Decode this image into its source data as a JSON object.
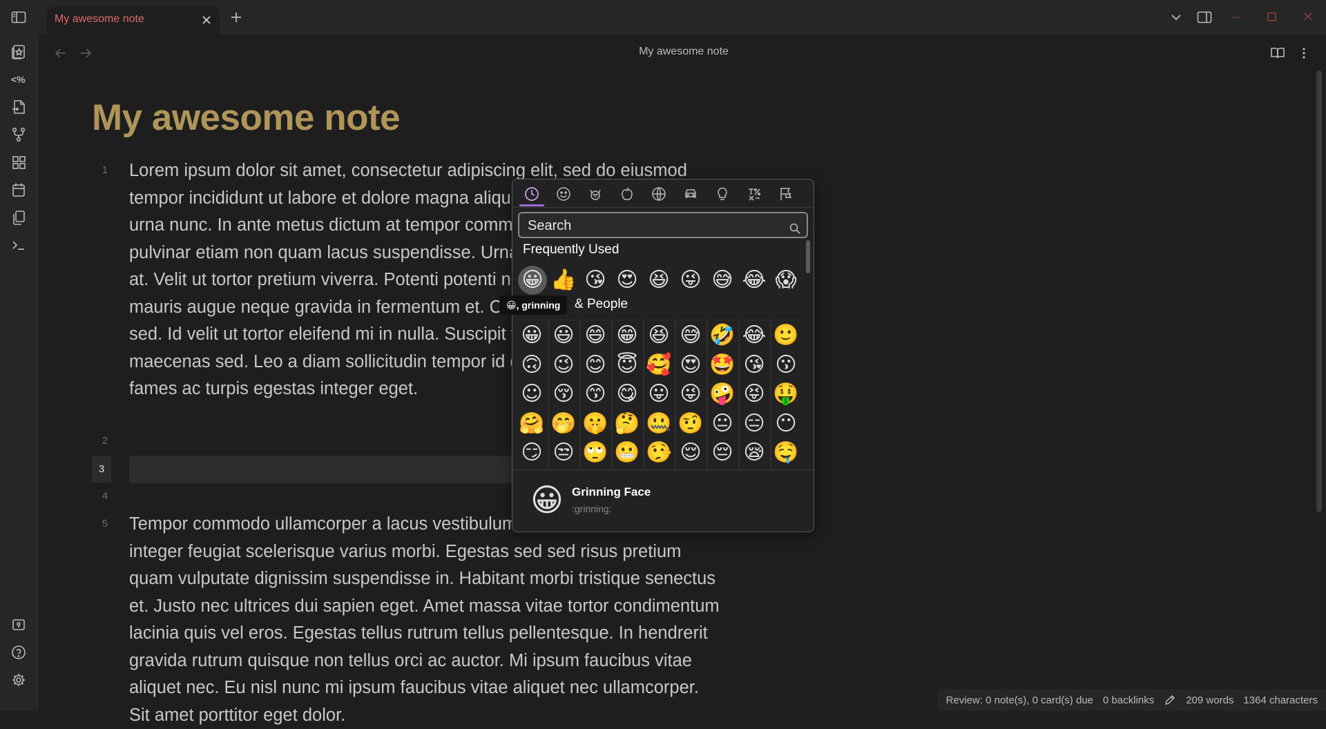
{
  "tab": {
    "title": "My awesome note",
    "new_tab_symbol": "+"
  },
  "view": {
    "title": "My awesome note"
  },
  "note": {
    "title": "My awesome note",
    "line_numbers": [
      "1",
      "2",
      "3",
      "4",
      "5"
    ],
    "paragraph1": "Lorem ipsum dolor sit amet, consectetur adipiscing elit, sed do eiusmod tempor incididunt ut labore et dolore magna aliqua. Vel risus tortor at auctor urna nunc. In ante metus dictum at tempor commodo. Quam elementum pulvinar etiam non quam lacus suspendisse. Urna adipiscing commodo elit at. Velit ut tortor pretium viverra. Potenti potenti nullam ac. Auctor augue mauris augue neque gravida in fermentum et. Cras pulvinar mattis nunc sed. Id velit ut tortor eleifend mi in nulla. Suscipit tellus mauris a diam maecenas sed. Leo a diam sollicitudin tempor id eu. Netus et malesuada fames ac turpis egestas integer eget.",
    "paragraph5": "Tempor commodo ullamcorper a lacus vestibulum sed arcu non odio. Tellus integer feugiat scelerisque varius morbi. Egestas sed sed risus pretium quam vulputate dignissim suspendisse in. Habitant morbi tristique senectus et. Justo nec ultrices dui sapien eget. Amet massa vitae tortor condimentum lacinia quis vel eros. Egestas tellus rutrum tellus pellentesque. In hendrerit gravida rutrum quisque non tellus orci ac auctor. Mi ipsum faucibus vitae aliquet nec. Eu nisl nunc mi ipsum faucibus vitae aliquet nec ullamcorper. Sit amet porttitor eget dolor."
  },
  "status": {
    "review": "Review: 0 note(s), 0 card(s) due",
    "backlinks": "0 backlinks",
    "words": "209 words",
    "characters": "1364 characters"
  },
  "picker": {
    "search_placeholder": "Search",
    "frequently_used_label": "Frequently Used",
    "smileys_label": "& People",
    "frequently_used": [
      "😀",
      "👍",
      "😘",
      "😍",
      "😆",
      "😜",
      "😅",
      "😂",
      "😱"
    ],
    "smileys": [
      [
        "😀",
        "😃",
        "😄",
        "😁",
        "😆",
        "😅",
        "🤣",
        "😂",
        "🙂"
      ],
      [
        "🙃",
        "😉",
        "😊",
        "😇",
        "🥰",
        "😍",
        "🤩",
        "😘",
        "😗"
      ],
      [
        "☺",
        "😚",
        "😙",
        "😋",
        "😛",
        "😜",
        "🤪",
        "😝",
        "🤑"
      ],
      [
        "🤗",
        "🤭",
        "🤫",
        "🤔",
        "🤐",
        "🤨",
        "😐",
        "😑",
        "😶"
      ],
      [
        "😏",
        "😒",
        "🙄",
        "😬",
        "🤥",
        "😌",
        "😔",
        "😪",
        "🤤"
      ]
    ],
    "tooltip": "😀, grinning",
    "preview": {
      "emoji": "😀",
      "name": "Grinning Face",
      "shortcode": ":grinning:"
    }
  },
  "colors": {
    "accent": "#9c6cd8",
    "title": "#b09559",
    "tab_title": "#e06b6b"
  }
}
